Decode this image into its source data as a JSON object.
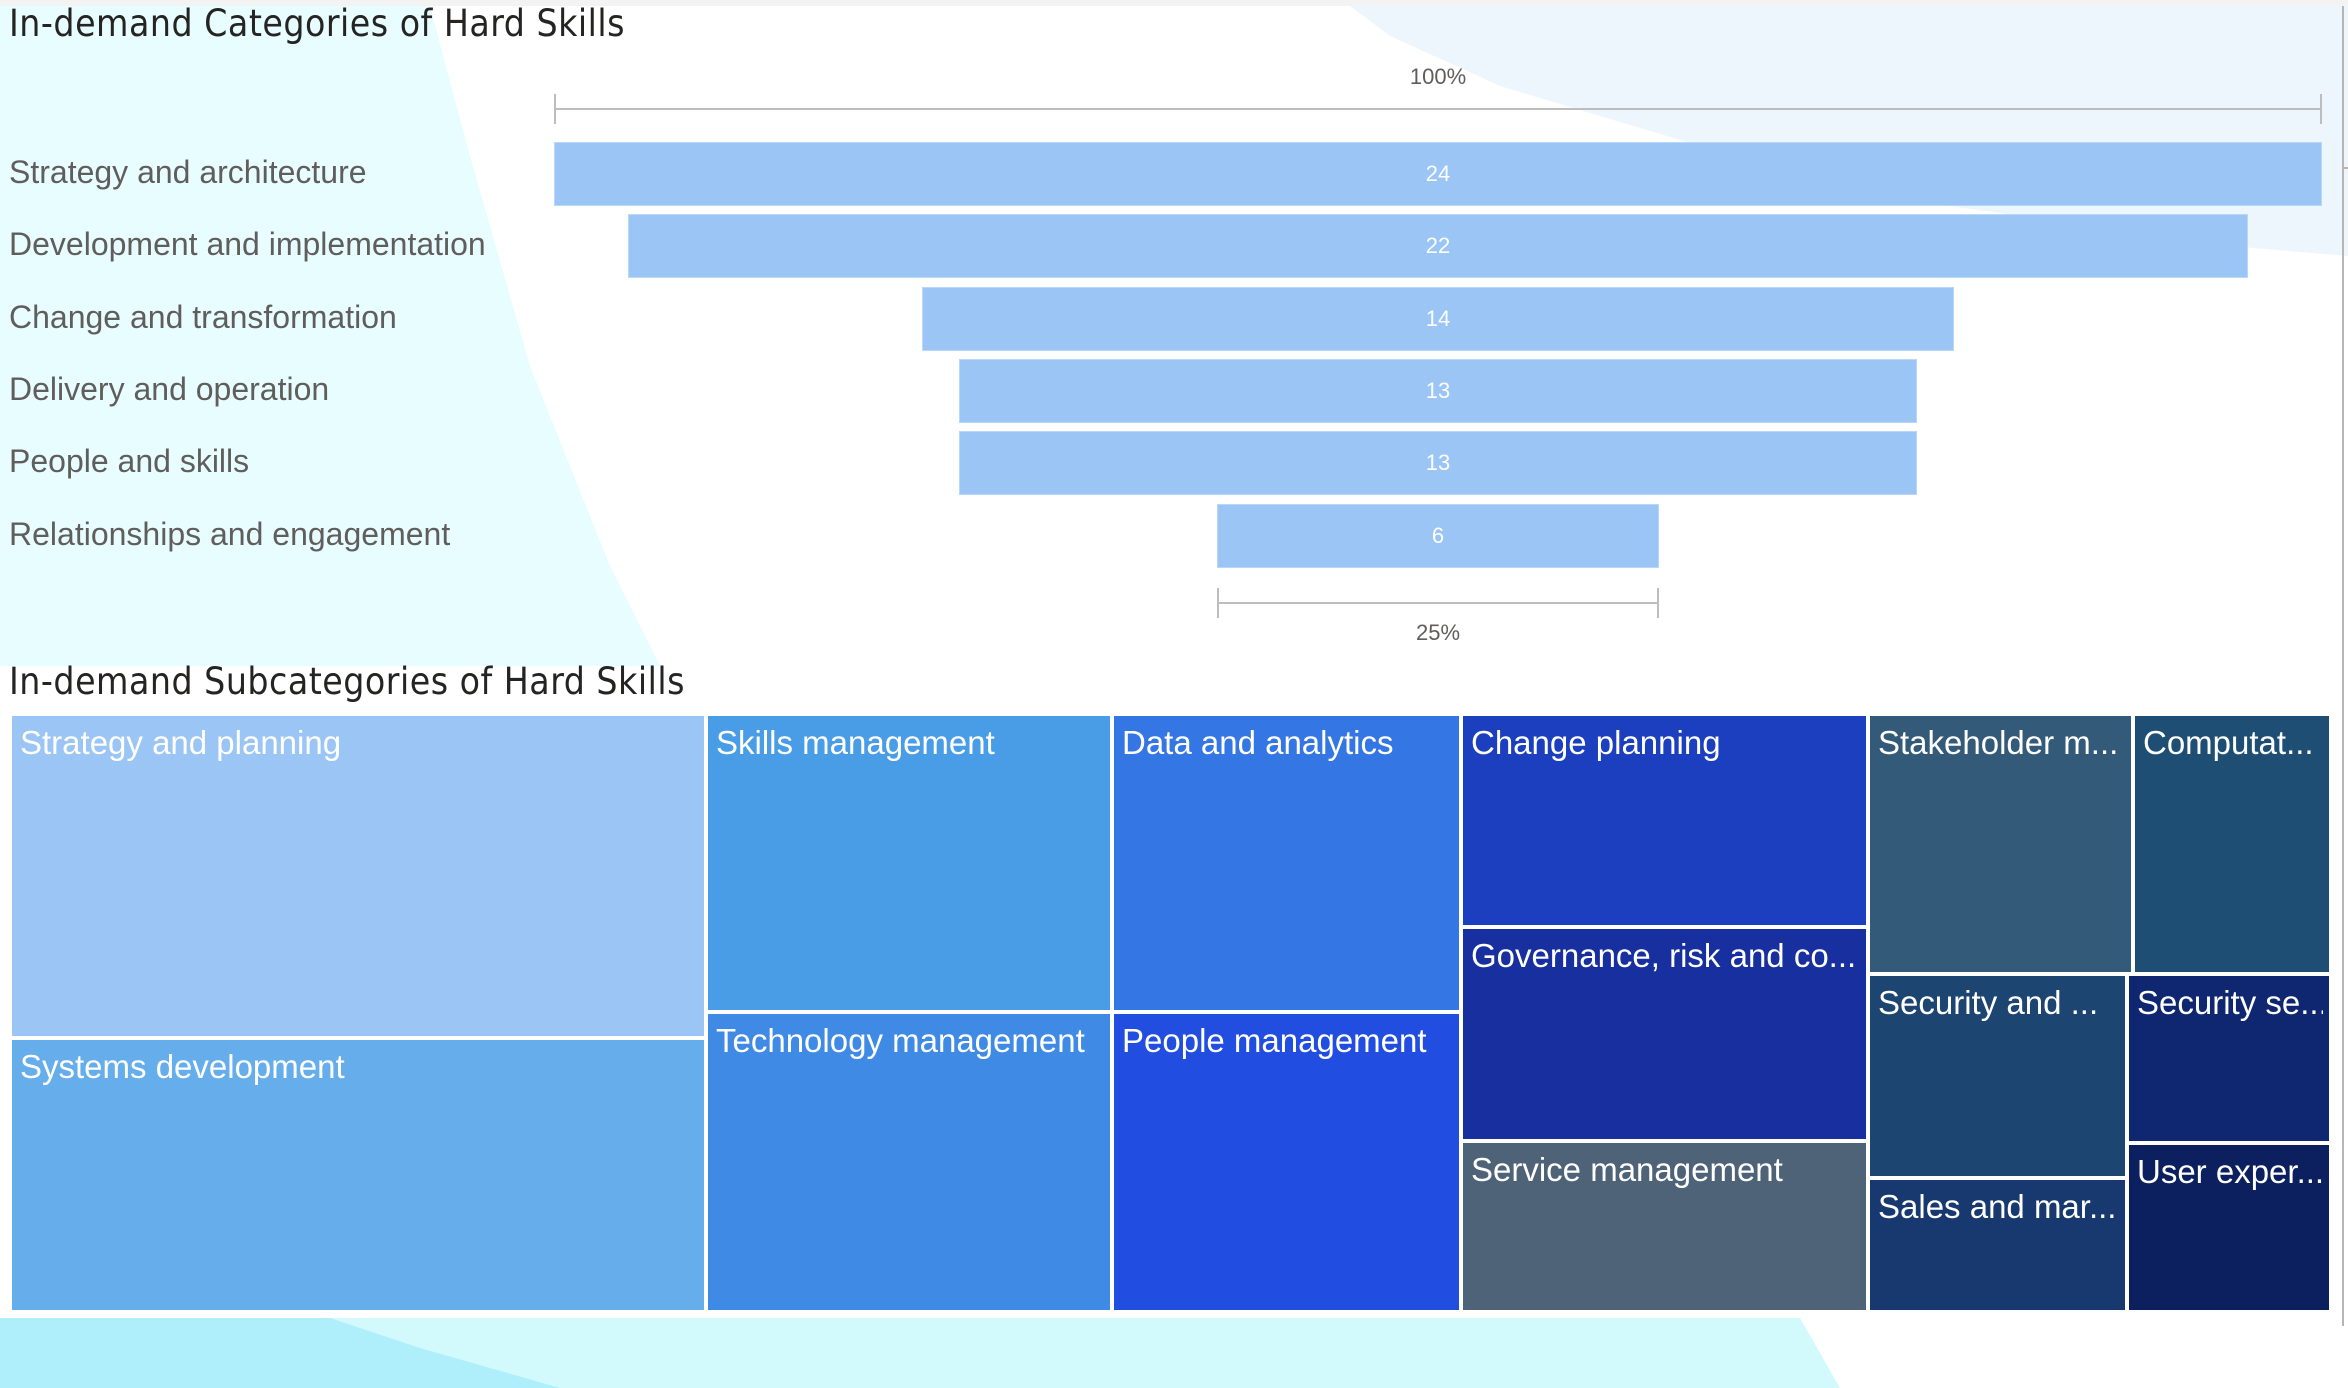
{
  "titles": {
    "funnel": "In-demand Categories of Hard Skills",
    "treemap": "In-demand Subcategories of Hard Skills"
  },
  "chart_data": [
    {
      "type": "funnel",
      "title": "In-demand Categories of Hard Skills",
      "categories": [
        "Strategy and architecture",
        "Development and implementation",
        "Change and transformation",
        "Delivery and operation",
        "People and skills",
        "Relationships and engagement"
      ],
      "values": [
        24,
        22,
        14,
        13,
        13,
        6
      ],
      "value_labels": [
        "24",
        "22",
        "14",
        "13",
        "13",
        "6"
      ],
      "top_axis_label": "100%",
      "bottom_axis_label": "25%",
      "bar_color": "#9ac5f4"
    },
    {
      "type": "treemap",
      "title": "In-demand Subcategories of Hard Skills",
      "items": [
        {
          "label": "Strategy and planning",
          "color": "#9ac5f4"
        },
        {
          "label": "Systems development",
          "color": "#65aeeb"
        },
        {
          "label": "Skills management",
          "color": "#499ce6"
        },
        {
          "label": "Technology management",
          "color": "#3f8ae5"
        },
        {
          "label": "Data and analytics",
          "color": "#3476e4"
        },
        {
          "label": "People management",
          "color": "#214ee0"
        },
        {
          "label": "Change planning",
          "color": "#1b3fbf"
        },
        {
          "label": "Governance, risk and co...",
          "color": "#182f9f"
        },
        {
          "label": "Service management",
          "color": "#4e6378"
        },
        {
          "label": "Stakeholder m...",
          "color": "#335a78"
        },
        {
          "label": "Computat...",
          "color": "#1f4e74"
        },
        {
          "label": "Security and ...",
          "color": "#1d4572"
        },
        {
          "label": "Sales and mar...",
          "color": "#183970"
        },
        {
          "label": "Security se...",
          "color": "#0f2670"
        },
        {
          "label": "User exper...",
          "color": "#0c1f5f"
        }
      ]
    }
  ]
}
